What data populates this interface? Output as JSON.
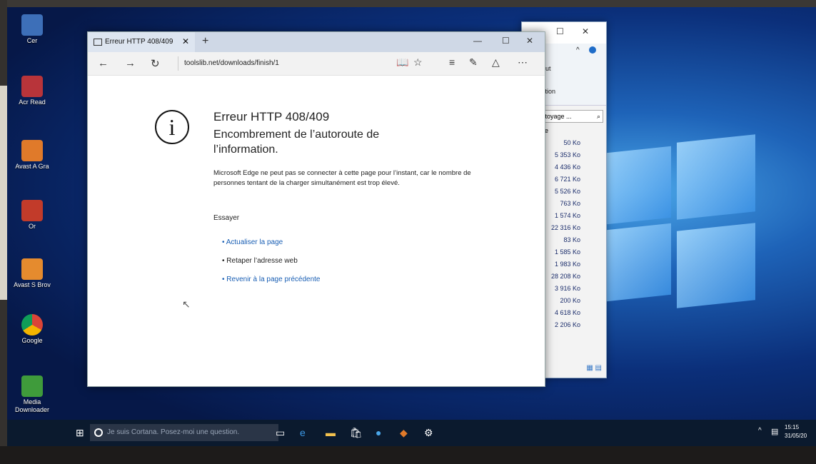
{
  "edge": {
    "tab_title": "Erreur HTTP 408/409",
    "address": "toolslib.net/downloads/finish/1",
    "error": {
      "title": "Erreur HTTP 408/409",
      "subtitle": "Encombrement de l’autoroute de l’information.",
      "description": "Microsoft Edge ne peut pas se connecter à cette page pour l’instant, car le nombre de personnes tentant de la charger simultanément est trop élevé.",
      "try_label": "Essayer",
      "options": [
        {
          "label": "Actualiser la page",
          "link": true
        },
        {
          "label": "Retaper l’adresse web",
          "link": false
        },
        {
          "label": "Revenir à la page précédente",
          "link": true
        }
      ]
    }
  },
  "explorer": {
    "ribbon_items": [
      "out",
      "ction"
    ],
    "search_text": "ttoyage ...",
    "column_header": "le",
    "sizes": [
      "50 Ko",
      "5 353 Ko",
      "4 436 Ko",
      "6 721 Ko",
      "5 526 Ko",
      "763 Ko",
      "1 574 Ko",
      "22 316 Ko",
      "83 Ko",
      "1 585 Ko",
      "1 983 Ko",
      "28 208 Ko",
      "3 916 Ko",
      "200 Ko",
      "4 618 Ko",
      "2 206 Ko"
    ]
  },
  "desktop_icons": [
    {
      "label": "Cer"
    },
    {
      "label": "Acr Read"
    },
    {
      "label": "Avast A Gra"
    },
    {
      "label": "Or"
    },
    {
      "label": "Avast S Brov"
    },
    {
      "label": "Google"
    },
    {
      "label": "Media Downloader"
    }
  ],
  "taskbar": {
    "cortana_placeholder": "Je suis Cortana. Posez-moi une question.",
    "time": "15:15",
    "date": "31/05/20"
  }
}
